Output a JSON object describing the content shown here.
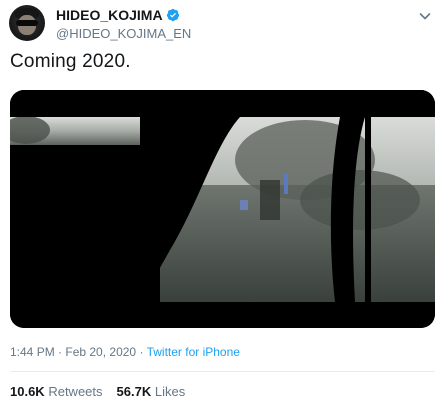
{
  "user": {
    "display_name": "HIDEO_KOJIMA",
    "handle": "@HIDEO_KOJIMA_EN",
    "verified": true
  },
  "tweet": {
    "text": "Coming 2020."
  },
  "meta": {
    "time": "1:44 PM",
    "separator": " · ",
    "date": "Feb 20, 2020",
    "source": "Twitter for iPhone"
  },
  "stats": {
    "retweets_count": "10.6K",
    "retweets_label": "Retweets",
    "likes_count": "56.7K",
    "likes_label": "Likes"
  },
  "colors": {
    "accent": "#1da1f2",
    "secondary_text": "#657786",
    "primary_text": "#14171a"
  },
  "icons": {
    "verified": "verified-badge-icon",
    "menu": "chevron-down-icon"
  }
}
